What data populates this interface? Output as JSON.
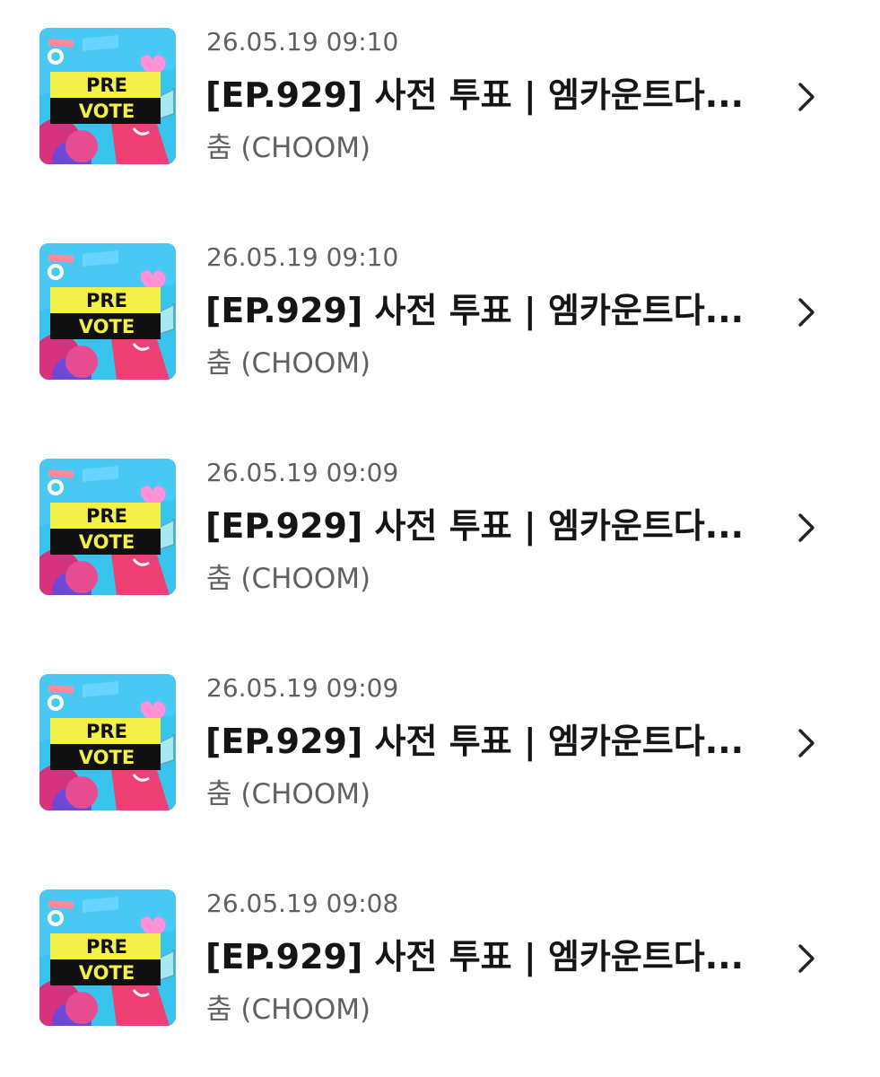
{
  "items": [
    {
      "date": "26.05.19 09:10",
      "title": "[EP.929] 사전 투표 | 엠카운트다...",
      "channel": "춤 (CHOOM)",
      "thumb_text": [
        "PRE",
        "VOTE"
      ]
    },
    {
      "date": "26.05.19 09:10",
      "title": "[EP.929] 사전 투표 | 엠카운트다...",
      "channel": "춤 (CHOOM)",
      "thumb_text": [
        "PRE",
        "VOTE"
      ]
    },
    {
      "date": "26.05.19 09:09",
      "title": "[EP.929] 사전 투표 | 엠카운트다...",
      "channel": "춤 (CHOOM)",
      "thumb_text": [
        "PRE",
        "VOTE"
      ]
    },
    {
      "date": "26.05.19 09:09",
      "title": "[EP.929] 사전 투표 | 엠카운트다...",
      "channel": "춤 (CHOOM)",
      "thumb_text": [
        "PRE",
        "VOTE"
      ]
    },
    {
      "date": "26.05.19 09:08",
      "title": "[EP.929] 사전 투표 | 엠카운트다...",
      "channel": "춤 (CHOOM)",
      "thumb_text": [
        "PRE",
        "VOTE"
      ]
    }
  ],
  "icons": {
    "row_arrow": "chevron-right-icon"
  },
  "colors": {
    "date_text": "#606060",
    "title_text": "#151515",
    "channel_text": "#616161",
    "thumb_bg": "#39c4ee",
    "banner_yellow": "#f3f04a",
    "banner_black": "#101010"
  }
}
